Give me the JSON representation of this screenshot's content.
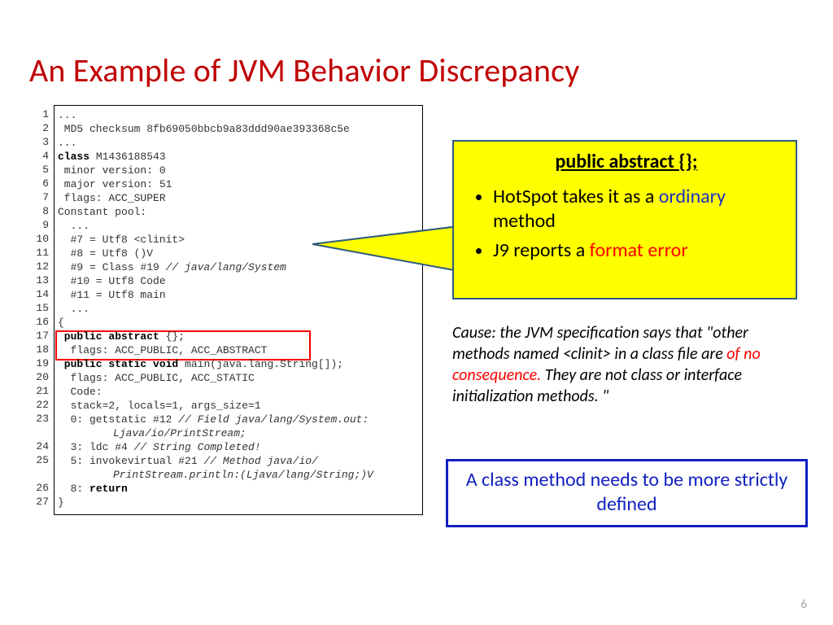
{
  "title": "An Example of JVM Behavior Discrepancy",
  "page_number": "6",
  "code": {
    "gutter": [
      "1",
      "2",
      "3",
      "4",
      "5",
      "6",
      "7",
      "8",
      "9",
      "10",
      "11",
      "12",
      "13",
      "14",
      "15",
      "16",
      "17",
      "18",
      "19",
      "20",
      "21",
      "22",
      "23",
      "",
      "24",
      "25",
      "",
      "26",
      "27"
    ],
    "lines": [
      {
        "t": "...",
        "cls": ""
      },
      {
        "t": " MD5 checksum 8fb69050bbcb9a83ddd90ae393368c5e",
        "cls": ""
      },
      {
        "t": "...",
        "cls": ""
      },
      {
        "t": "class M1436188543",
        "cls": "kw",
        "plain": " M1436188543",
        "pre": "class"
      },
      {
        "t": " minor version: 0",
        "cls": ""
      },
      {
        "t": " major version: 51",
        "cls": ""
      },
      {
        "t": " flags: ACC_SUPER",
        "cls": ""
      },
      {
        "t": "Constant pool:",
        "cls": ""
      },
      {
        "t": "  ...",
        "cls": ""
      },
      {
        "t": "  #7 = Utf8 <clinit>",
        "cls": ""
      },
      {
        "t": "  #8 = Utf8 ()V",
        "cls": ""
      },
      {
        "t": "  #9 = Class #19 // java/lang/System",
        "cls": "it",
        "plain": "  #9 = Class #19 ",
        "tail": "// java/lang/System"
      },
      {
        "t": "  #10 = Utf8 Code",
        "cls": ""
      },
      {
        "t": "  #11 = Utf8 main",
        "cls": ""
      },
      {
        "t": "  ...",
        "cls": ""
      },
      {
        "t": "{",
        "cls": ""
      },
      {
        "t": " public abstract {};",
        "cls": "kw",
        "pre": " public abstract",
        "plain": " {};"
      },
      {
        "t": "  flags: ACC_PUBLIC, ACC_ABSTRACT",
        "cls": ""
      },
      {
        "t": " public static void main(java.lang.String[]);",
        "cls": "kw",
        "pre": " public static void",
        "plain": " main(java.lang.String[]);"
      },
      {
        "t": "  flags: ACC_PUBLIC, ACC_STATIC",
        "cls": ""
      },
      {
        "t": "  Code:",
        "cls": ""
      },
      {
        "t": "  stack=2, locals=1, args_size=1",
        "cls": ""
      },
      {
        "t": "  0: getstatic #12 // Field java/lang/System.out:",
        "cls": "it",
        "plain": "  0: getstatic #12 ",
        "tail": "// Field java/lang/System.out:"
      },
      {
        "t": "Ljava/io/PrintStream;",
        "cls": "it wrap",
        "tail": "Ljava/io/PrintStream;"
      },
      {
        "t": "  3: ldc #4 // String Completed!",
        "cls": "it",
        "plain": "  3: ldc #4 ",
        "tail": "// String Completed!"
      },
      {
        "t": "  5: invokevirtual #21 // Method java/io/",
        "cls": "it",
        "plain": "  5: invokevirtual #21 ",
        "tail": "// Method java/io/"
      },
      {
        "t": "PrintStream.println:(Ljava/lang/String;)V",
        "cls": "it wrap",
        "tail": "PrintStream.println:(Ljava/lang/String;)V"
      },
      {
        "t": "  8: return",
        "cls": "kw",
        "pre": "  8: ",
        "kwtext": "return"
      },
      {
        "t": "}",
        "cls": ""
      }
    ]
  },
  "callout": {
    "title": "public abstract {};",
    "items": [
      {
        "pre": "HotSpot takes it as a ",
        "hl": "ordinary",
        "hlcls": "blue-word",
        "post": " method"
      },
      {
        "pre": "J9 reports a ",
        "hl": "format error",
        "hlcls": "red-word",
        "post": ""
      }
    ]
  },
  "cause": {
    "pre": "Cause: the JVM specification says that \"other methods named <clinit> in a class file are ",
    "hl": "of no consequence.",
    "post": " They are not class or interface initialization methods. \""
  },
  "conclusion": "A class method needs to be more strictly defined"
}
